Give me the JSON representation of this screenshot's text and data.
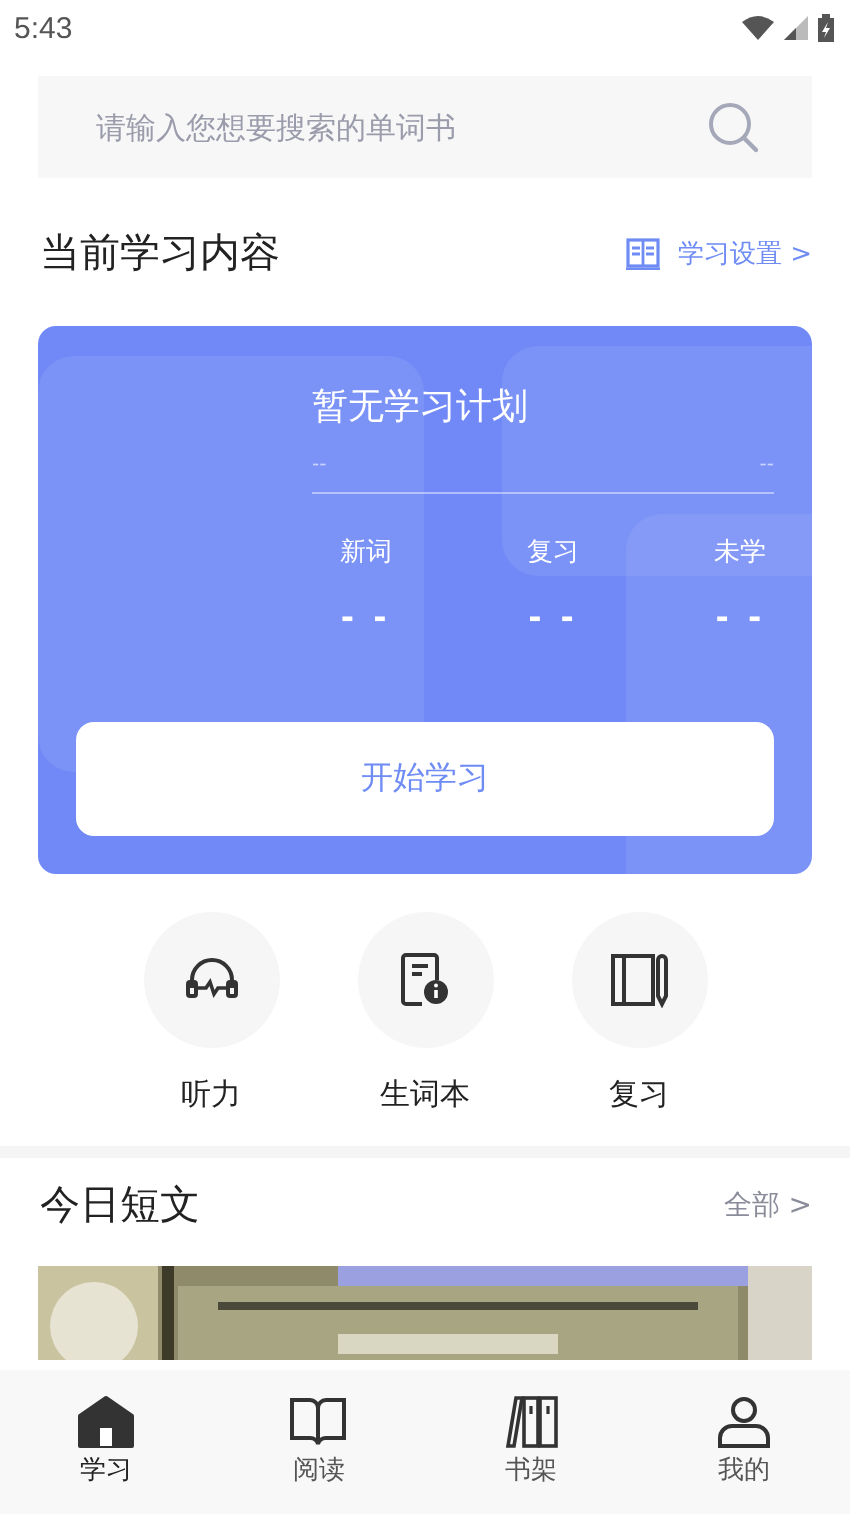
{
  "status_bar": {
    "time": "5:43"
  },
  "search": {
    "placeholder": "请输入您想要搜索的单词书"
  },
  "current_section": {
    "title": "当前学习内容",
    "settings_link": "学习设置 >"
  },
  "plan_card": {
    "title": "暂无学习计划",
    "left_value": "--",
    "right_value": "--",
    "stats": [
      {
        "label": "新词",
        "value": "- -"
      },
      {
        "label": "复习",
        "value": "- -"
      },
      {
        "label": "未学",
        "value": "- -"
      }
    ],
    "button": "开始学习"
  },
  "shortcuts": [
    {
      "kind": "listening",
      "label": "听力"
    },
    {
      "kind": "vocabulary",
      "label": "生词本"
    },
    {
      "kind": "review",
      "label": "复习"
    }
  ],
  "daily_section": {
    "title": "今日短文",
    "more_link": "全部 >"
  },
  "tabs": [
    {
      "kind": "home",
      "label": "学习",
      "selected": true
    },
    {
      "kind": "read",
      "label": "阅读",
      "selected": false
    },
    {
      "kind": "shelf",
      "label": "书架",
      "selected": false
    },
    {
      "kind": "profile",
      "label": "我的",
      "selected": false
    }
  ]
}
